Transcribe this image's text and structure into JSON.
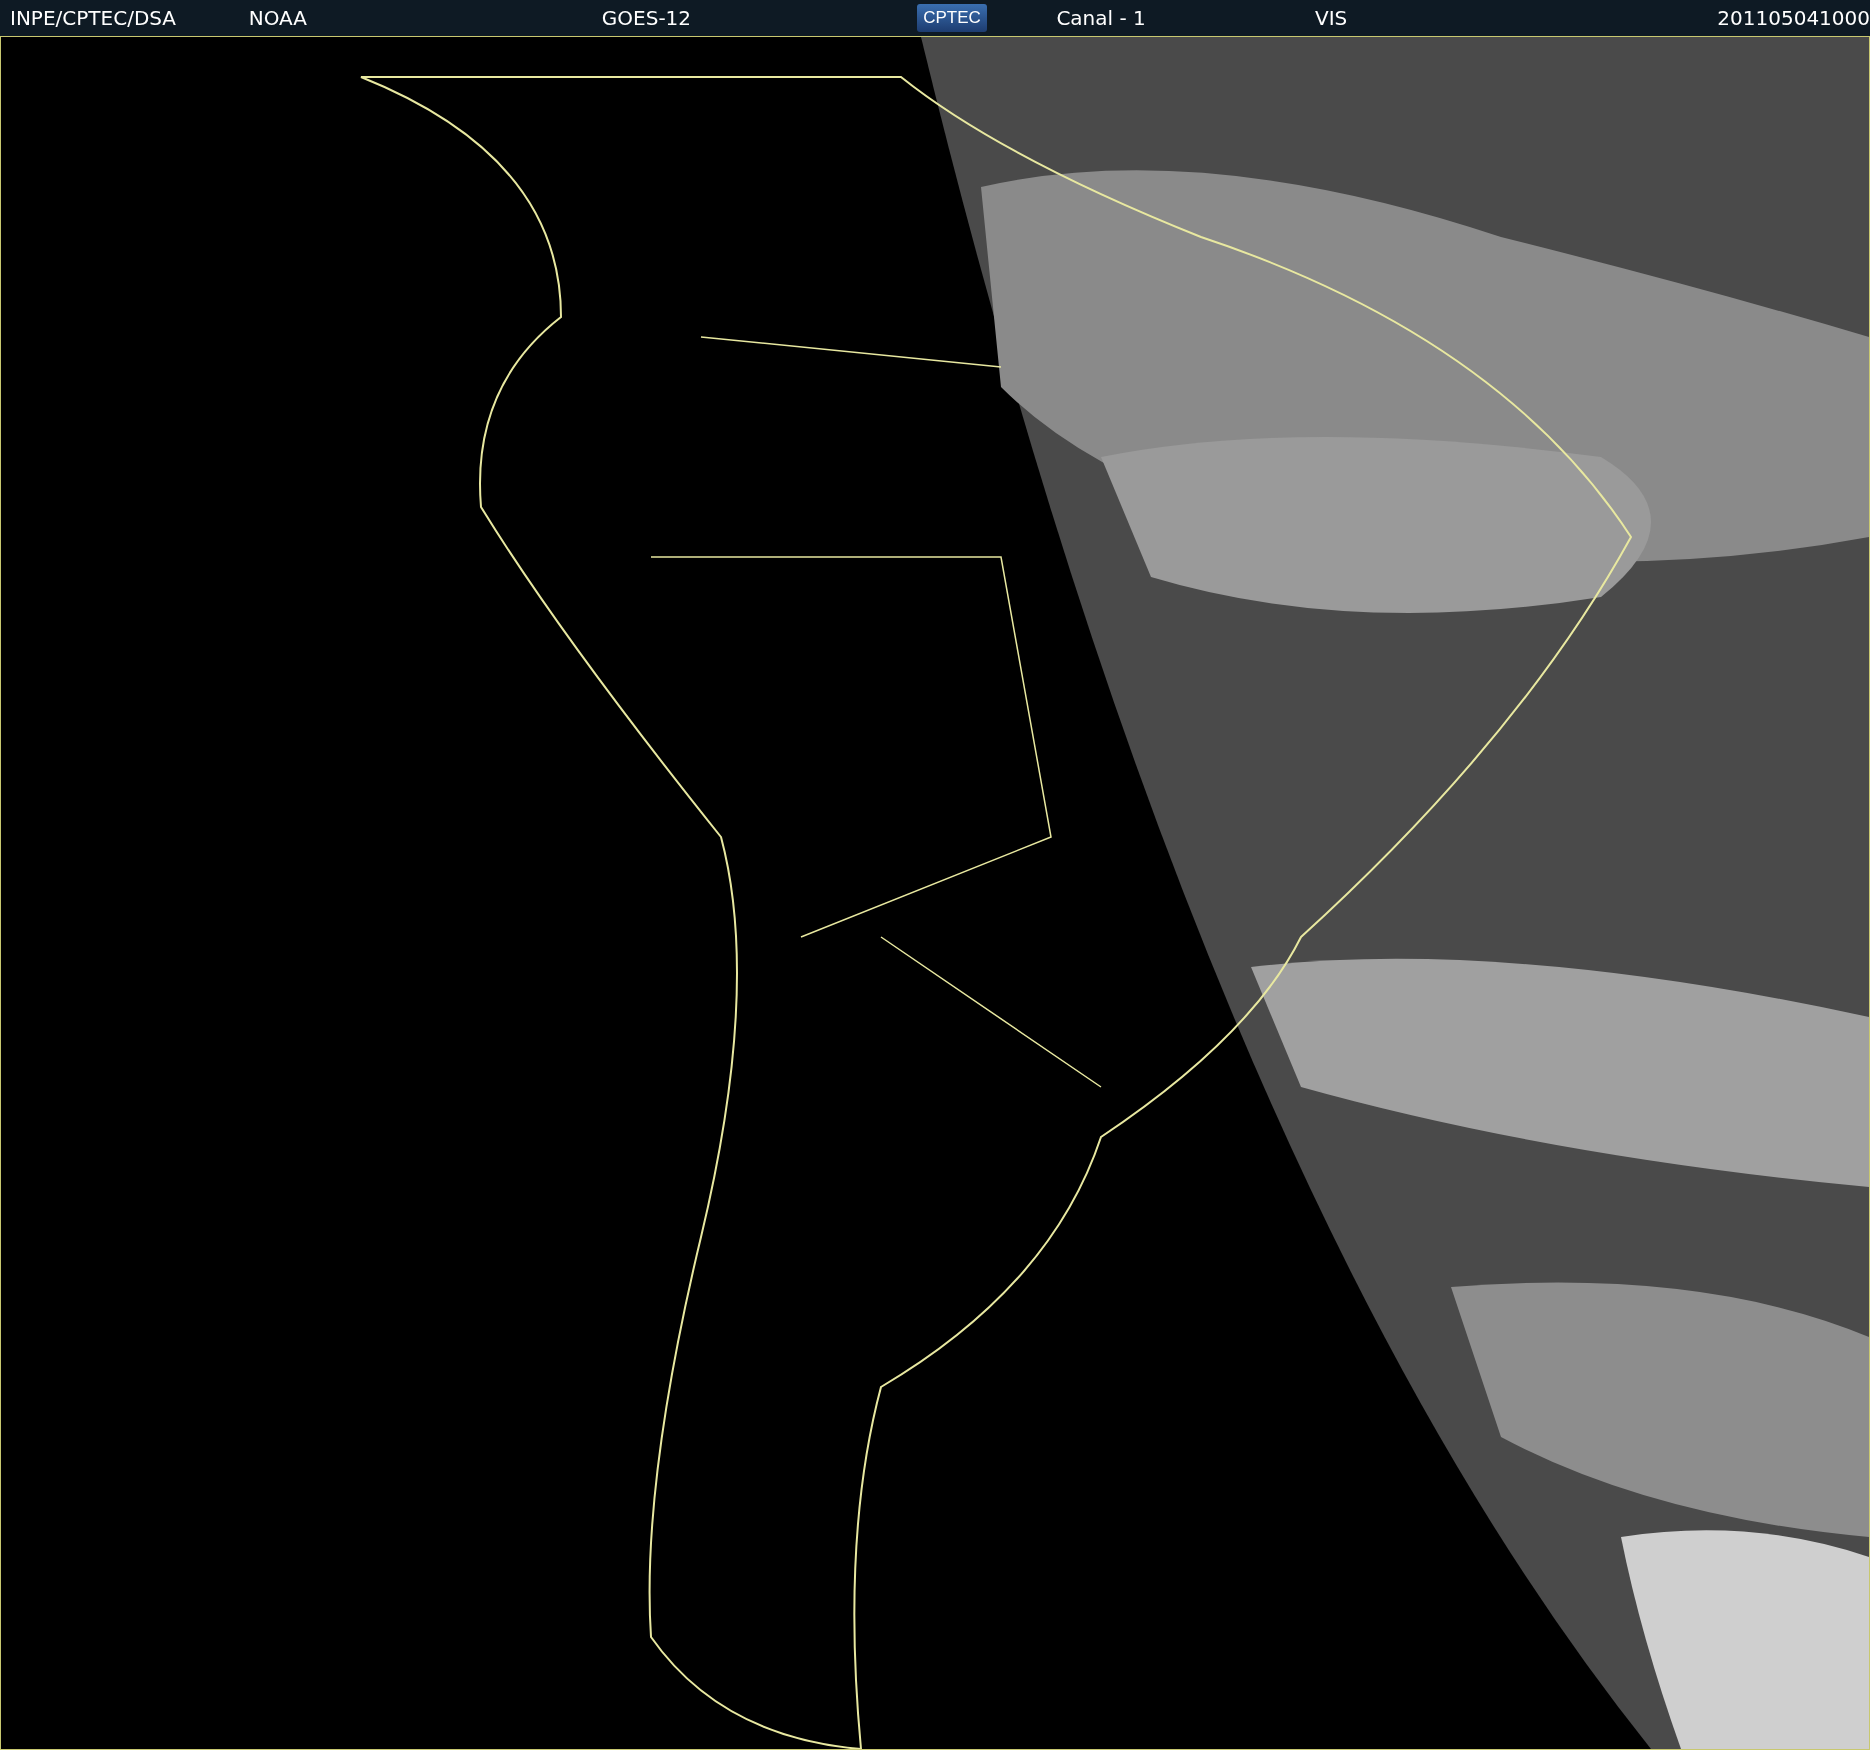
{
  "header": {
    "items": [
      {
        "kind": "text",
        "text": "INPE/CPTEC/DSA"
      },
      {
        "kind": "text",
        "text": "NOAA"
      },
      {
        "kind": "text",
        "text": "GOES-12"
      },
      {
        "kind": "logo",
        "text": "CPTEC"
      },
      {
        "kind": "text",
        "text": "Canal - 1"
      },
      {
        "kind": "text",
        "text": "VIS"
      },
      {
        "kind": "text",
        "text": "201105041000"
      }
    ]
  }
}
